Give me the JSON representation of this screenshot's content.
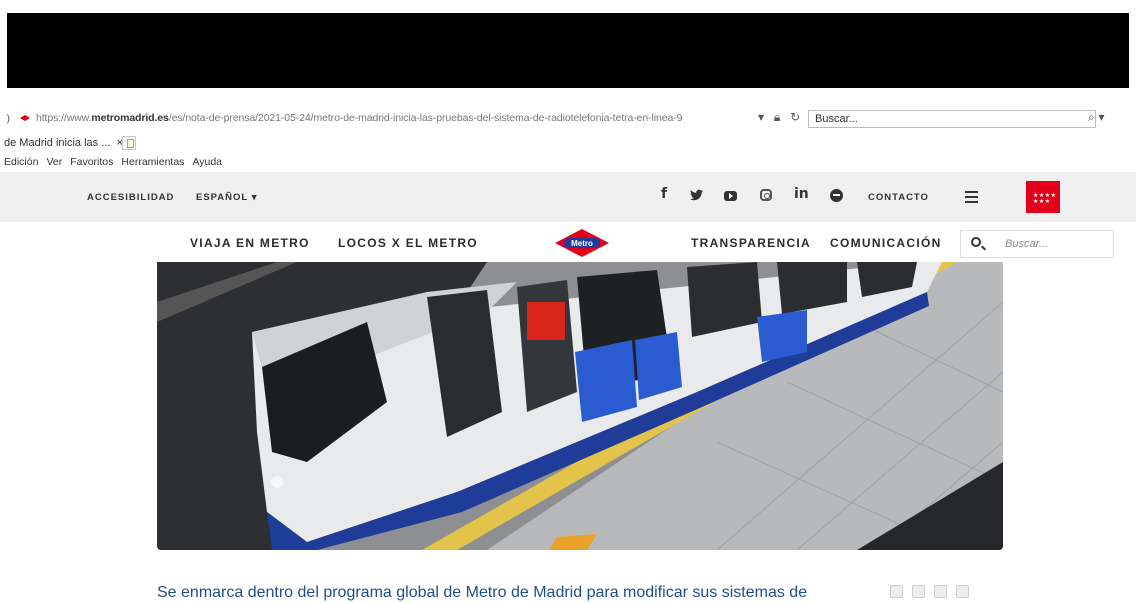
{
  "browser": {
    "url_prefix": "https://www.",
    "url_domain": "metromadrid.es",
    "url_path": "/es/nota-de-prensa/2021-05-24/metro-de-madrid-inicia-las-pruebas-del-sistema-de-radiotelefonia-tetra-en-linea-9",
    "search_placeholder": "Buscar...",
    "tab_title": "de Madrid inicia las ...",
    "tab_close": "×",
    "menu": [
      "Edición",
      "Ver",
      "Favoritos",
      "Herramientas",
      "Ayuda"
    ]
  },
  "topbar": {
    "accessibility": "ACCESIBILIDAD",
    "language": "ESPAÑOL",
    "contact": "CONTACTO",
    "social": [
      "facebook-icon",
      "twitter-icon",
      "youtube-icon",
      "instagram-icon",
      "linkedin-icon",
      "spotify-icon"
    ],
    "social_glyphs": {
      "facebook": "f",
      "linkedin": "in"
    }
  },
  "nav": {
    "items": [
      "VIAJA EN METRO",
      "LOCOS X EL METRO",
      "TRANSPARENCIA",
      "COMUNICACIÓN"
    ],
    "logo_text": "Metro",
    "search_placeholder": "Buscar..."
  },
  "article": {
    "lead": "Se enmarca dentro del programa global de Metro de Madrid para modificar sus sistemas de"
  },
  "colors": {
    "brand_red": "#e2001a",
    "metro_blue": "#1f3c99",
    "link_blue": "#1f4e8c"
  }
}
